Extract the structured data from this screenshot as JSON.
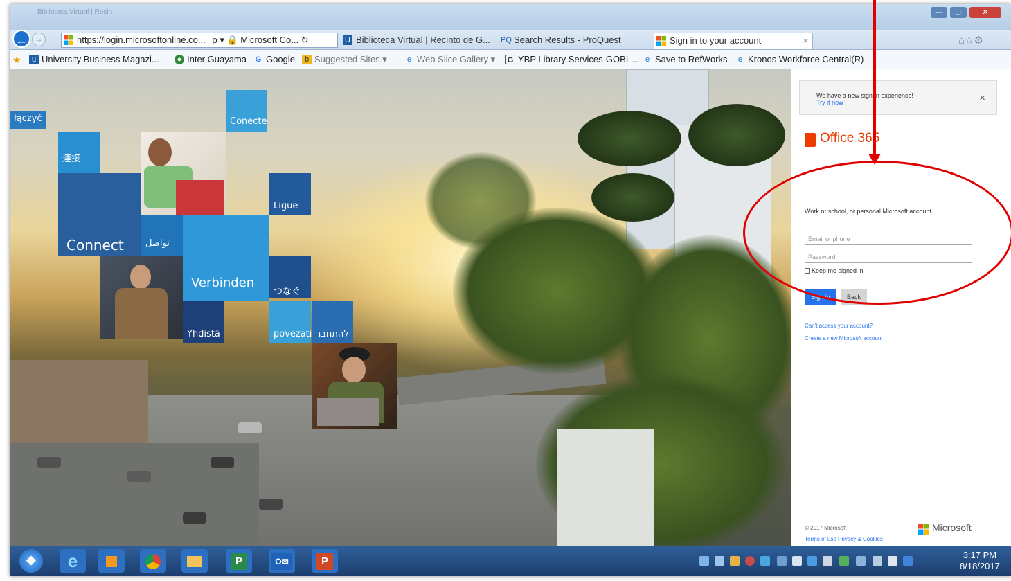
{
  "browser": {
    "ghost_tab": "Biblioteca Virtual | Recin",
    "address": "https://login.microsoftonline.co...",
    "address_tools": "ρ ▾ 🔒 Microsoft Co... ↻",
    "tabs": [
      {
        "label": "Biblioteca Virtual | Recinto de G...",
        "icon": "biblioteca-icon"
      },
      {
        "label": "Search Results - ProQuest",
        "icon": "proquest-icon"
      },
      {
        "label": "Sign in to your account",
        "icon": "microsoft-icon"
      }
    ],
    "tab_close": "×",
    "favorites": [
      {
        "label": "University Business Magazi...",
        "icon": "magazine-icon"
      },
      {
        "label": "Inter Guayama",
        "icon": "inter-icon"
      },
      {
        "label": "Google",
        "icon": "google-icon"
      },
      {
        "label": "Suggested Sites ▾",
        "icon": "bing-icon"
      },
      {
        "label": "Web Slice Gallery ▾",
        "icon": "ie-icon"
      },
      {
        "label": "YBP Library Services-GOBI ...",
        "icon": "gobi-icon"
      },
      {
        "label": "Save to RefWorks",
        "icon": "ie-icon"
      },
      {
        "label": "Kronos Workforce Central(R)",
        "icon": "ie-icon"
      }
    ]
  },
  "tiles": {
    "laczyc": "łączyć",
    "conecte": "Conecte",
    "lianjie": "連接",
    "ligue": "Ligue",
    "connect": "Connect",
    "arabic": "تواصل",
    "verbinden": "Verbinden",
    "tsunagu": "つなぐ",
    "yhdista": "Yhdistä",
    "povezati": "povezati",
    "hebrew": "להתחבר"
  },
  "signin": {
    "notice_text": "We have a new sign-in experience!",
    "notice_link": "Try it now",
    "close": "×",
    "product": "Office 365",
    "account_label": "Work or school, or personal Microsoft account",
    "email_placeholder": "Email or phone",
    "password_placeholder": "Password",
    "keep_signed_in": "Keep me signed in",
    "sign_in": "Sign in",
    "back": "Back",
    "cant_access": "Can't access your account?",
    "create_account": "Create a new Microsoft account",
    "copyright": "© 2017 Microsoft",
    "terms": "Terms of use   Privacy & Cookies",
    "brand": "Microsoft"
  },
  "taskbar": {
    "apps": [
      "start-icon",
      "ie-icon",
      "media-icon",
      "chrome-icon",
      "explorer-icon",
      "publisher-icon",
      "outlook-icon",
      "powerpoint-icon"
    ],
    "outlook_label": "O✉",
    "powerpoint_label": "P",
    "publisher_label": "P",
    "time": "3:17 PM",
    "date": "8/18/2017"
  },
  "colors": {
    "ms_blue": "#2672ec",
    "office_orange": "#eb3c00",
    "annotation_red": "#e00000"
  }
}
